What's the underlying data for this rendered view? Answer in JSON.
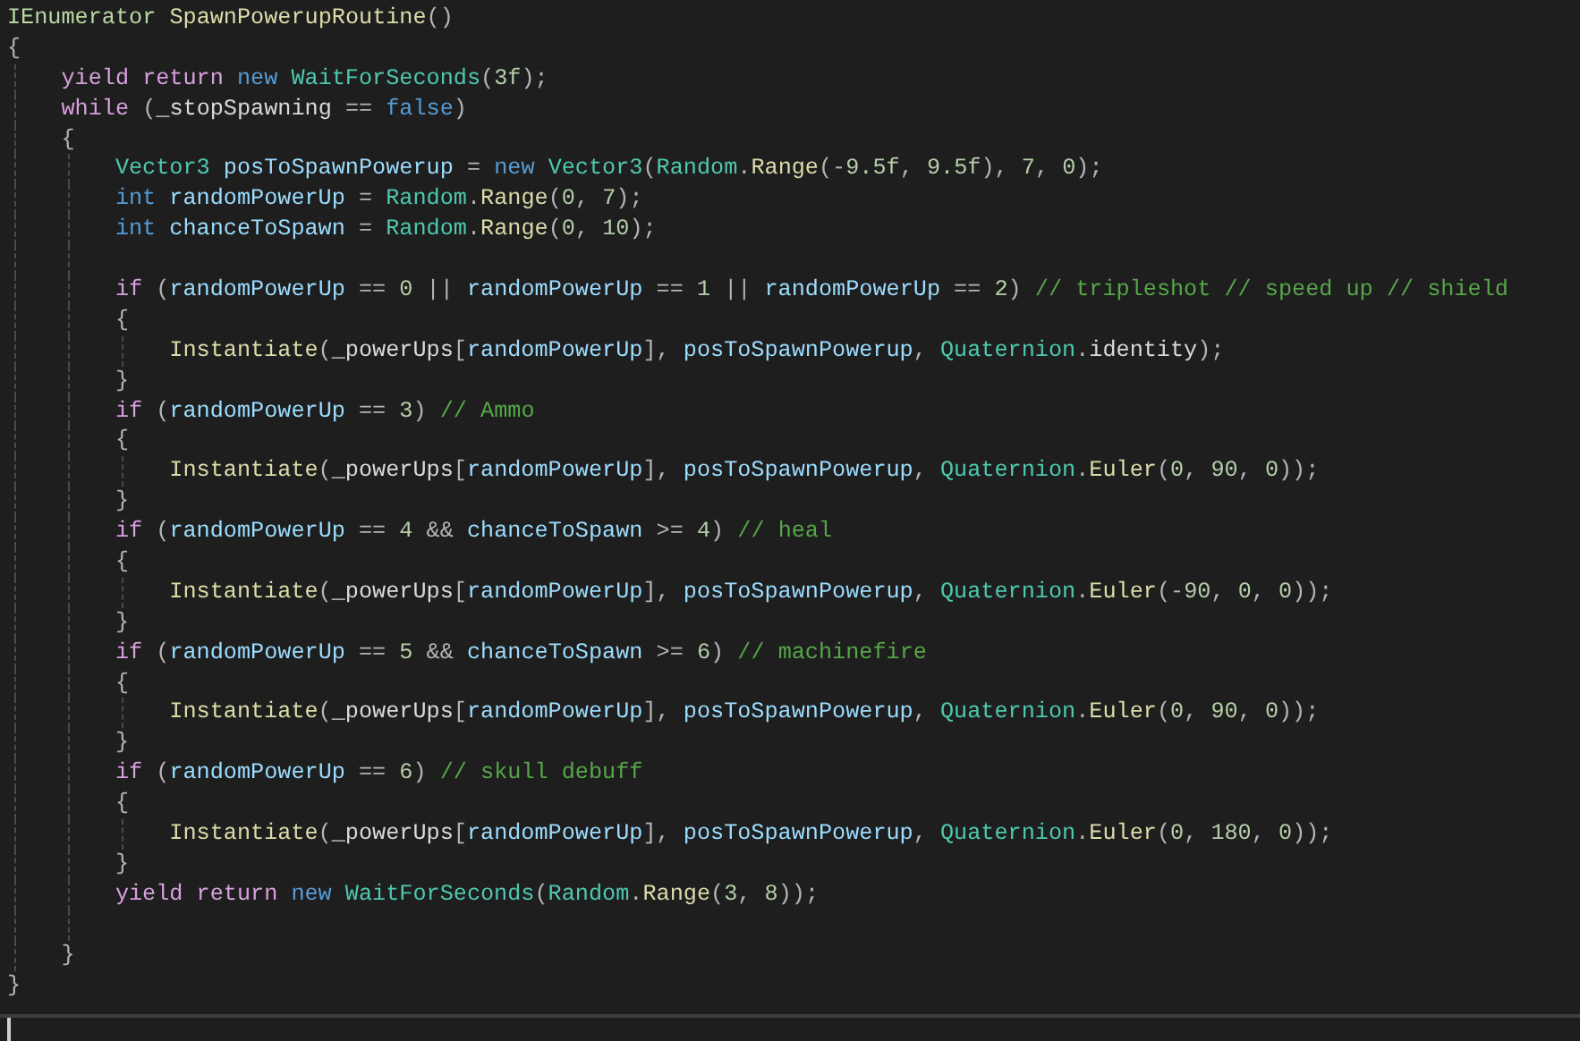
{
  "editor": {
    "lines": [
      {
        "kind": "code",
        "tokens": [
          {
            "kind": "interface",
            "text": "IEnumerator "
          },
          {
            "kind": "method",
            "text": "SpawnPowerupRoutine"
          },
          {
            "kind": "plain",
            "text": "()"
          }
        ]
      },
      {
        "kind": "code",
        "tokens": [
          {
            "kind": "plain",
            "text": "{"
          }
        ],
        "children": [
          {
            "kind": "code",
            "tokens": [
              {
                "kind": "control",
                "text": "yield return "
              },
              {
                "kind": "keyword",
                "text": "new "
              },
              {
                "kind": "type",
                "text": "WaitForSeconds"
              },
              {
                "kind": "plain",
                "text": "("
              },
              {
                "kind": "number",
                "text": "3f"
              },
              {
                "kind": "plain",
                "text": ");"
              }
            ]
          },
          {
            "kind": "code",
            "tokens": [
              {
                "kind": "control",
                "text": "while"
              },
              {
                "kind": "plain",
                "text": " ("
              },
              {
                "kind": "field",
                "text": "_stopSpawning"
              },
              {
                "kind": "plain",
                "text": " == "
              },
              {
                "kind": "keyword",
                "text": "false"
              },
              {
                "kind": "plain",
                "text": ")"
              }
            ]
          },
          {
            "kind": "code",
            "tokens": [
              {
                "kind": "plain",
                "text": "{"
              }
            ],
            "children": [
              {
                "kind": "code",
                "tokens": [
                  {
                    "kind": "type",
                    "text": "Vector3 "
                  },
                  {
                    "kind": "local",
                    "text": "posToSpawnPowerup"
                  },
                  {
                    "kind": "plain",
                    "text": " = "
                  },
                  {
                    "kind": "keyword",
                    "text": "new "
                  },
                  {
                    "kind": "type",
                    "text": "Vector3"
                  },
                  {
                    "kind": "plain",
                    "text": "("
                  },
                  {
                    "kind": "type",
                    "text": "Random"
                  },
                  {
                    "kind": "plain",
                    "text": "."
                  },
                  {
                    "kind": "method",
                    "text": "Range"
                  },
                  {
                    "kind": "plain",
                    "text": "(-"
                  },
                  {
                    "kind": "number",
                    "text": "9.5f"
                  },
                  {
                    "kind": "plain",
                    "text": ", "
                  },
                  {
                    "kind": "number",
                    "text": "9.5f"
                  },
                  {
                    "kind": "plain",
                    "text": "), "
                  },
                  {
                    "kind": "number",
                    "text": "7"
                  },
                  {
                    "kind": "plain",
                    "text": ", "
                  },
                  {
                    "kind": "number",
                    "text": "0"
                  },
                  {
                    "kind": "plain",
                    "text": ");"
                  }
                ]
              },
              {
                "kind": "code",
                "tokens": [
                  {
                    "kind": "keyword",
                    "text": "int "
                  },
                  {
                    "kind": "local",
                    "text": "randomPowerUp"
                  },
                  {
                    "kind": "plain",
                    "text": " = "
                  },
                  {
                    "kind": "type",
                    "text": "Random"
                  },
                  {
                    "kind": "plain",
                    "text": "."
                  },
                  {
                    "kind": "method",
                    "text": "Range"
                  },
                  {
                    "kind": "plain",
                    "text": "("
                  },
                  {
                    "kind": "number",
                    "text": "0"
                  },
                  {
                    "kind": "plain",
                    "text": ", "
                  },
                  {
                    "kind": "number",
                    "text": "7"
                  },
                  {
                    "kind": "plain",
                    "text": ");"
                  }
                ]
              },
              {
                "kind": "code",
                "tokens": [
                  {
                    "kind": "keyword",
                    "text": "int "
                  },
                  {
                    "kind": "local",
                    "text": "chanceToSpawn"
                  },
                  {
                    "kind": "plain",
                    "text": " = "
                  },
                  {
                    "kind": "type",
                    "text": "Random"
                  },
                  {
                    "kind": "plain",
                    "text": "."
                  },
                  {
                    "kind": "method",
                    "text": "Range"
                  },
                  {
                    "kind": "plain",
                    "text": "("
                  },
                  {
                    "kind": "number",
                    "text": "0"
                  },
                  {
                    "kind": "plain",
                    "text": ", "
                  },
                  {
                    "kind": "number",
                    "text": "10"
                  },
                  {
                    "kind": "plain",
                    "text": ");"
                  }
                ]
              },
              {
                "kind": "blank"
              },
              {
                "kind": "code",
                "tokens": [
                  {
                    "kind": "control",
                    "text": "if"
                  },
                  {
                    "kind": "plain",
                    "text": " ("
                  },
                  {
                    "kind": "local",
                    "text": "randomPowerUp"
                  },
                  {
                    "kind": "plain",
                    "text": " == "
                  },
                  {
                    "kind": "number",
                    "text": "0"
                  },
                  {
                    "kind": "plain",
                    "text": " || "
                  },
                  {
                    "kind": "local",
                    "text": "randomPowerUp"
                  },
                  {
                    "kind": "plain",
                    "text": " == "
                  },
                  {
                    "kind": "number",
                    "text": "1"
                  },
                  {
                    "kind": "plain",
                    "text": " || "
                  },
                  {
                    "kind": "local",
                    "text": "randomPowerUp"
                  },
                  {
                    "kind": "plain",
                    "text": " == "
                  },
                  {
                    "kind": "number",
                    "text": "2"
                  },
                  {
                    "kind": "plain",
                    "text": ") "
                  },
                  {
                    "kind": "comment",
                    "text": "// tripleshot // speed up // shield"
                  }
                ]
              },
              {
                "kind": "code",
                "tokens": [
                  {
                    "kind": "plain",
                    "text": "{"
                  }
                ],
                "children": [
                  {
                    "kind": "code",
                    "tokens": [
                      {
                        "kind": "method",
                        "text": "Instantiate"
                      },
                      {
                        "kind": "plain",
                        "text": "("
                      },
                      {
                        "kind": "field",
                        "text": "_powerUps"
                      },
                      {
                        "kind": "plain",
                        "text": "["
                      },
                      {
                        "kind": "local",
                        "text": "randomPowerUp"
                      },
                      {
                        "kind": "plain",
                        "text": "], "
                      },
                      {
                        "kind": "local",
                        "text": "posToSpawnPowerup"
                      },
                      {
                        "kind": "plain",
                        "text": ", "
                      },
                      {
                        "kind": "type",
                        "text": "Quaternion"
                      },
                      {
                        "kind": "plain",
                        "text": "."
                      },
                      {
                        "kind": "field",
                        "text": "identity"
                      },
                      {
                        "kind": "plain",
                        "text": ");"
                      }
                    ]
                  }
                ]
              },
              {
                "kind": "code",
                "tokens": [
                  {
                    "kind": "plain",
                    "text": "}"
                  }
                ]
              },
              {
                "kind": "code",
                "tokens": [
                  {
                    "kind": "control",
                    "text": "if"
                  },
                  {
                    "kind": "plain",
                    "text": " ("
                  },
                  {
                    "kind": "local",
                    "text": "randomPowerUp"
                  },
                  {
                    "kind": "plain",
                    "text": " == "
                  },
                  {
                    "kind": "number",
                    "text": "3"
                  },
                  {
                    "kind": "plain",
                    "text": ") "
                  },
                  {
                    "kind": "comment",
                    "text": "// Ammo"
                  }
                ]
              },
              {
                "kind": "code",
                "tokens": [
                  {
                    "kind": "plain",
                    "text": "{"
                  }
                ],
                "children": [
                  {
                    "kind": "code",
                    "tokens": [
                      {
                        "kind": "method",
                        "text": "Instantiate"
                      },
                      {
                        "kind": "plain",
                        "text": "("
                      },
                      {
                        "kind": "field",
                        "text": "_powerUps"
                      },
                      {
                        "kind": "plain",
                        "text": "["
                      },
                      {
                        "kind": "local",
                        "text": "randomPowerUp"
                      },
                      {
                        "kind": "plain",
                        "text": "], "
                      },
                      {
                        "kind": "local",
                        "text": "posToSpawnPowerup"
                      },
                      {
                        "kind": "plain",
                        "text": ", "
                      },
                      {
                        "kind": "type",
                        "text": "Quaternion"
                      },
                      {
                        "kind": "plain",
                        "text": "."
                      },
                      {
                        "kind": "method",
                        "text": "Euler"
                      },
                      {
                        "kind": "plain",
                        "text": "("
                      },
                      {
                        "kind": "number",
                        "text": "0"
                      },
                      {
                        "kind": "plain",
                        "text": ", "
                      },
                      {
                        "kind": "number",
                        "text": "90"
                      },
                      {
                        "kind": "plain",
                        "text": ", "
                      },
                      {
                        "kind": "number",
                        "text": "0"
                      },
                      {
                        "kind": "plain",
                        "text": "));"
                      }
                    ]
                  }
                ]
              },
              {
                "kind": "code",
                "tokens": [
                  {
                    "kind": "plain",
                    "text": "}"
                  }
                ]
              },
              {
                "kind": "code",
                "tokens": [
                  {
                    "kind": "control",
                    "text": "if"
                  },
                  {
                    "kind": "plain",
                    "text": " ("
                  },
                  {
                    "kind": "local",
                    "text": "randomPowerUp"
                  },
                  {
                    "kind": "plain",
                    "text": " == "
                  },
                  {
                    "kind": "number",
                    "text": "4"
                  },
                  {
                    "kind": "plain",
                    "text": " && "
                  },
                  {
                    "kind": "local",
                    "text": "chanceToSpawn"
                  },
                  {
                    "kind": "plain",
                    "text": " >= "
                  },
                  {
                    "kind": "number",
                    "text": "4"
                  },
                  {
                    "kind": "plain",
                    "text": ") "
                  },
                  {
                    "kind": "comment",
                    "text": "// heal"
                  }
                ]
              },
              {
                "kind": "code",
                "tokens": [
                  {
                    "kind": "plain",
                    "text": "{"
                  }
                ],
                "children": [
                  {
                    "kind": "code",
                    "tokens": [
                      {
                        "kind": "method",
                        "text": "Instantiate"
                      },
                      {
                        "kind": "plain",
                        "text": "("
                      },
                      {
                        "kind": "field",
                        "text": "_powerUps"
                      },
                      {
                        "kind": "plain",
                        "text": "["
                      },
                      {
                        "kind": "local",
                        "text": "randomPowerUp"
                      },
                      {
                        "kind": "plain",
                        "text": "], "
                      },
                      {
                        "kind": "local",
                        "text": "posToSpawnPowerup"
                      },
                      {
                        "kind": "plain",
                        "text": ", "
                      },
                      {
                        "kind": "type",
                        "text": "Quaternion"
                      },
                      {
                        "kind": "plain",
                        "text": "."
                      },
                      {
                        "kind": "method",
                        "text": "Euler"
                      },
                      {
                        "kind": "plain",
                        "text": "(-"
                      },
                      {
                        "kind": "number",
                        "text": "90"
                      },
                      {
                        "kind": "plain",
                        "text": ", "
                      },
                      {
                        "kind": "number",
                        "text": "0"
                      },
                      {
                        "kind": "plain",
                        "text": ", "
                      },
                      {
                        "kind": "number",
                        "text": "0"
                      },
                      {
                        "kind": "plain",
                        "text": "));"
                      }
                    ]
                  }
                ]
              },
              {
                "kind": "code",
                "tokens": [
                  {
                    "kind": "plain",
                    "text": "}"
                  }
                ]
              },
              {
                "kind": "code",
                "tokens": [
                  {
                    "kind": "control",
                    "text": "if"
                  },
                  {
                    "kind": "plain",
                    "text": " ("
                  },
                  {
                    "kind": "local",
                    "text": "randomPowerUp"
                  },
                  {
                    "kind": "plain",
                    "text": " == "
                  },
                  {
                    "kind": "number",
                    "text": "5"
                  },
                  {
                    "kind": "plain",
                    "text": " && "
                  },
                  {
                    "kind": "local",
                    "text": "chanceToSpawn"
                  },
                  {
                    "kind": "plain",
                    "text": " >= "
                  },
                  {
                    "kind": "number",
                    "text": "6"
                  },
                  {
                    "kind": "plain",
                    "text": ") "
                  },
                  {
                    "kind": "comment",
                    "text": "// machinefire"
                  }
                ]
              },
              {
                "kind": "code",
                "tokens": [
                  {
                    "kind": "plain",
                    "text": "{"
                  }
                ],
                "children": [
                  {
                    "kind": "code",
                    "tokens": [
                      {
                        "kind": "method",
                        "text": "Instantiate"
                      },
                      {
                        "kind": "plain",
                        "text": "("
                      },
                      {
                        "kind": "field",
                        "text": "_powerUps"
                      },
                      {
                        "kind": "plain",
                        "text": "["
                      },
                      {
                        "kind": "local",
                        "text": "randomPowerUp"
                      },
                      {
                        "kind": "plain",
                        "text": "], "
                      },
                      {
                        "kind": "local",
                        "text": "posToSpawnPowerup"
                      },
                      {
                        "kind": "plain",
                        "text": ", "
                      },
                      {
                        "kind": "type",
                        "text": "Quaternion"
                      },
                      {
                        "kind": "plain",
                        "text": "."
                      },
                      {
                        "kind": "method",
                        "text": "Euler"
                      },
                      {
                        "kind": "plain",
                        "text": "("
                      },
                      {
                        "kind": "number",
                        "text": "0"
                      },
                      {
                        "kind": "plain",
                        "text": ", "
                      },
                      {
                        "kind": "number",
                        "text": "90"
                      },
                      {
                        "kind": "plain",
                        "text": ", "
                      },
                      {
                        "kind": "number",
                        "text": "0"
                      },
                      {
                        "kind": "plain",
                        "text": "));"
                      }
                    ]
                  }
                ]
              },
              {
                "kind": "code",
                "tokens": [
                  {
                    "kind": "plain",
                    "text": "}"
                  }
                ]
              },
              {
                "kind": "code",
                "tokens": [
                  {
                    "kind": "control",
                    "text": "if"
                  },
                  {
                    "kind": "plain",
                    "text": " ("
                  },
                  {
                    "kind": "local",
                    "text": "randomPowerUp"
                  },
                  {
                    "kind": "plain",
                    "text": " == "
                  },
                  {
                    "kind": "number",
                    "text": "6"
                  },
                  {
                    "kind": "plain",
                    "text": ") "
                  },
                  {
                    "kind": "comment",
                    "text": "// skull debuff"
                  }
                ]
              },
              {
                "kind": "code",
                "tokens": [
                  {
                    "kind": "plain",
                    "text": "{"
                  }
                ],
                "children": [
                  {
                    "kind": "code",
                    "tokens": [
                      {
                        "kind": "method",
                        "text": "Instantiate"
                      },
                      {
                        "kind": "plain",
                        "text": "("
                      },
                      {
                        "kind": "field",
                        "text": "_powerUps"
                      },
                      {
                        "kind": "plain",
                        "text": "["
                      },
                      {
                        "kind": "local",
                        "text": "randomPowerUp"
                      },
                      {
                        "kind": "plain",
                        "text": "], "
                      },
                      {
                        "kind": "local",
                        "text": "posToSpawnPowerup"
                      },
                      {
                        "kind": "plain",
                        "text": ", "
                      },
                      {
                        "kind": "type",
                        "text": "Quaternion"
                      },
                      {
                        "kind": "plain",
                        "text": "."
                      },
                      {
                        "kind": "method",
                        "text": "Euler"
                      },
                      {
                        "kind": "plain",
                        "text": "("
                      },
                      {
                        "kind": "number",
                        "text": "0"
                      },
                      {
                        "kind": "plain",
                        "text": ", "
                      },
                      {
                        "kind": "number",
                        "text": "180"
                      },
                      {
                        "kind": "plain",
                        "text": ", "
                      },
                      {
                        "kind": "number",
                        "text": "0"
                      },
                      {
                        "kind": "plain",
                        "text": "));"
                      }
                    ]
                  }
                ]
              },
              {
                "kind": "code",
                "tokens": [
                  {
                    "kind": "plain",
                    "text": "}"
                  }
                ]
              },
              {
                "kind": "code",
                "tokens": [
                  {
                    "kind": "control",
                    "text": "yield return "
                  },
                  {
                    "kind": "keyword",
                    "text": "new "
                  },
                  {
                    "kind": "type",
                    "text": "WaitForSeconds"
                  },
                  {
                    "kind": "plain",
                    "text": "("
                  },
                  {
                    "kind": "type",
                    "text": "Random"
                  },
                  {
                    "kind": "plain",
                    "text": "."
                  },
                  {
                    "kind": "method",
                    "text": "Range"
                  },
                  {
                    "kind": "plain",
                    "text": "("
                  },
                  {
                    "kind": "number",
                    "text": "3"
                  },
                  {
                    "kind": "plain",
                    "text": ", "
                  },
                  {
                    "kind": "number",
                    "text": "8"
                  },
                  {
                    "kind": "plain",
                    "text": "));"
                  }
                ]
              },
              {
                "kind": "blank"
              }
            ]
          },
          {
            "kind": "code",
            "tokens": [
              {
                "kind": "plain",
                "text": "}"
              }
            ]
          }
        ]
      },
      {
        "kind": "code",
        "tokens": [
          {
            "kind": "plain",
            "text": "}"
          }
        ]
      }
    ]
  }
}
